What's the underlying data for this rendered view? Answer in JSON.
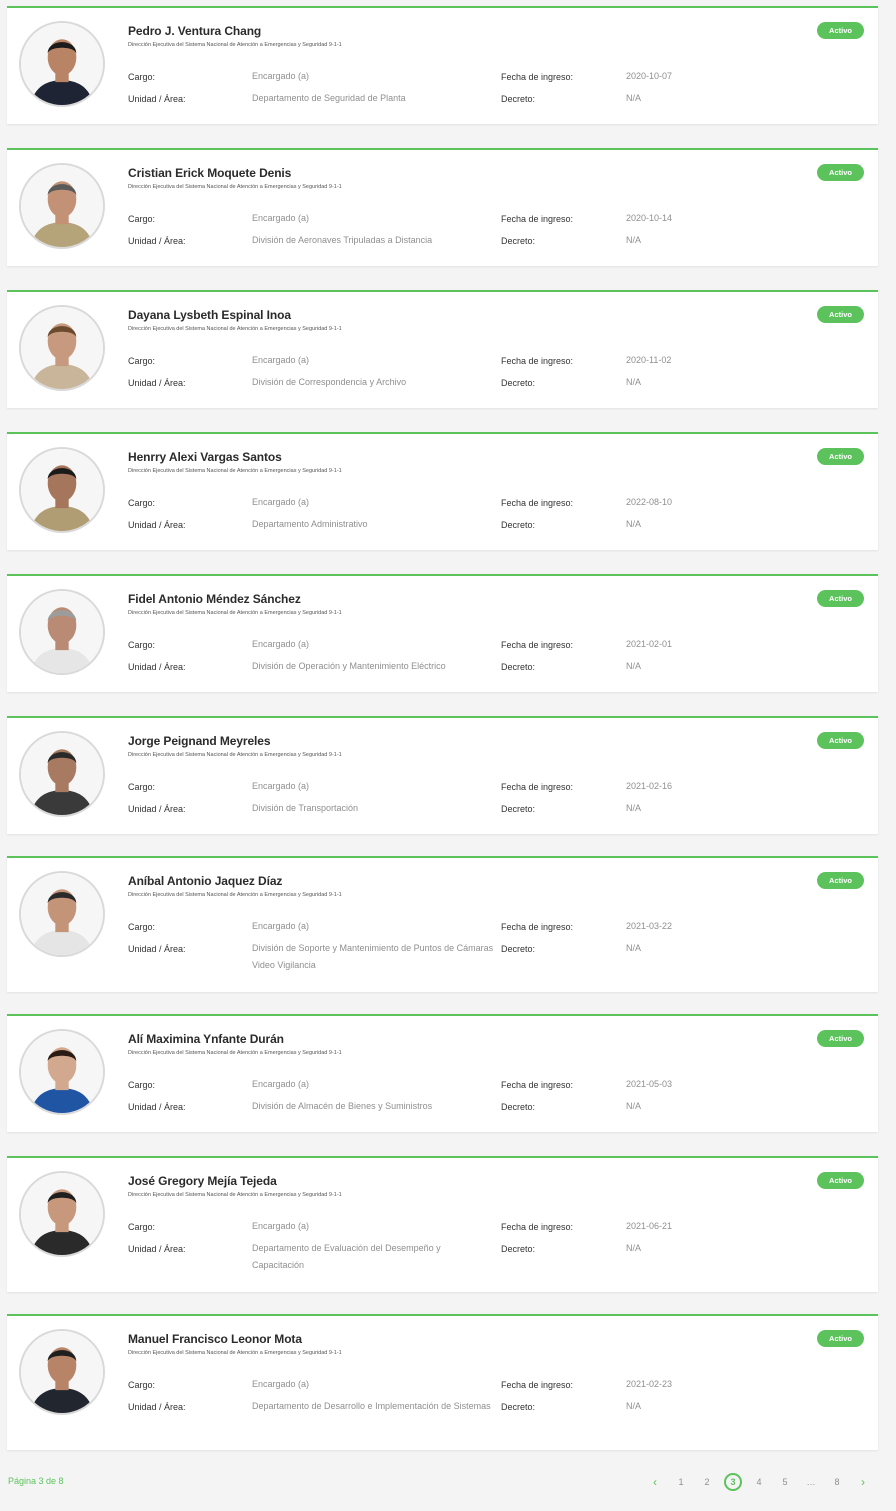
{
  "labels": {
    "cargo": "Cargo:",
    "unidad": "Unidad / Área:",
    "fecha": "Fecha de ingreso:",
    "decreto": "Decreto:"
  },
  "colors": {
    "accent": "#5cc35c",
    "badge_text": "#ffffff"
  },
  "employees": [
    {
      "name": "Pedro J. Ventura Chang",
      "org": "Dirección Ejecutiva del Sistema Nacional de Atención a Emergencias y Seguridad 9-1-1",
      "cargo": "Encargado (a)",
      "unidad": "Departamento de Seguridad de Planta",
      "fecha": "2020-10-07",
      "decreto": "N/A",
      "status": "Activo"
    },
    {
      "name": "Cristian Erick Moquete Denis",
      "org": "Dirección Ejecutiva del Sistema Nacional de Atención a Emergencias y Seguridad 9-1-1",
      "cargo": "Encargado (a)",
      "unidad": "División de Aeronaves Tripuladas a Distancia",
      "fecha": "2020-10-14",
      "decreto": "N/A",
      "status": "Activo"
    },
    {
      "name": "Dayana Lysbeth Espinal Inoa",
      "org": "Dirección Ejecutiva del Sistema Nacional de Atención a Emergencias y Seguridad 9-1-1",
      "cargo": "Encargado (a)",
      "unidad": "División de Correspondencia y Archivo",
      "fecha": "2020-11-02",
      "decreto": "N/A",
      "status": "Activo"
    },
    {
      "name": "Henrry Alexi Vargas Santos",
      "org": "Dirección Ejecutiva del Sistema Nacional de Atención a Emergencias y Seguridad 9-1-1",
      "cargo": "Encargado (a)",
      "unidad": "Departamento Administrativo",
      "fecha": "2022-08-10",
      "decreto": "N/A",
      "status": "Activo"
    },
    {
      "name": "Fidel Antonio Méndez Sánchez",
      "org": "Dirección Ejecutiva del Sistema Nacional de Atención a Emergencias y Seguridad 9-1-1",
      "cargo": "Encargado (a)",
      "unidad": "División de Operación y Mantenimiento Eléctrico",
      "fecha": "2021-02-01",
      "decreto": "N/A",
      "status": "Activo"
    },
    {
      "name": "Jorge Peignand Meyreles",
      "org": "Dirección Ejecutiva del Sistema Nacional de Atención a Emergencias y Seguridad 9-1-1",
      "cargo": "Encargado (a)",
      "unidad": "División de Transportación",
      "fecha": "2021-02-16",
      "decreto": "N/A",
      "status": "Activo"
    },
    {
      "name": "Aníbal Antonio Jaquez Díaz",
      "org": "Dirección Ejecutiva del Sistema Nacional de Atención a Emergencias y Seguridad 9-1-1",
      "cargo": "Encargado (a)",
      "unidad": "División de Soporte y Mantenimiento de Puntos de Cámaras Video Vigilancia",
      "fecha": "2021-03-22",
      "decreto": "N/A",
      "status": "Activo"
    },
    {
      "name": "Alí Maximina Ynfante Durán",
      "org": "Dirección Ejecutiva del Sistema Nacional de Atención a Emergencias y Seguridad 9-1-1",
      "cargo": "Encargado (a)",
      "unidad": "División de Almacén de Bienes y Suministros",
      "fecha": "2021-05-03",
      "decreto": "N/A",
      "status": "Activo"
    },
    {
      "name": "José Gregory Mejía Tejeda",
      "org": "Dirección Ejecutiva del Sistema Nacional de Atención a Emergencias y Seguridad 9-1-1",
      "cargo": "Encargado (a)",
      "unidad": "Departamento de Evaluación del Desempeño y Capacitación",
      "fecha": "2021-06-21",
      "decreto": "N/A",
      "status": "Activo"
    },
    {
      "name": "Manuel Francisco Leonor Mota",
      "org": "Dirección Ejecutiva del Sistema Nacional de Atención a Emergencias y Seguridad 9-1-1",
      "cargo": "Encargado (a)",
      "unidad": "Departamento de Desarrollo e Implementación de Sistemas",
      "fecha": "2021-02-23",
      "decreto": "N/A",
      "status": "Activo"
    }
  ],
  "footer": {
    "page_info": "Página 3 de 8",
    "prev_icon": "chevron-left-icon",
    "next_icon": "chevron-right-icon",
    "pages": [
      "1",
      "2",
      "3",
      "4",
      "5",
      "…",
      "8"
    ],
    "current_page": "3"
  }
}
